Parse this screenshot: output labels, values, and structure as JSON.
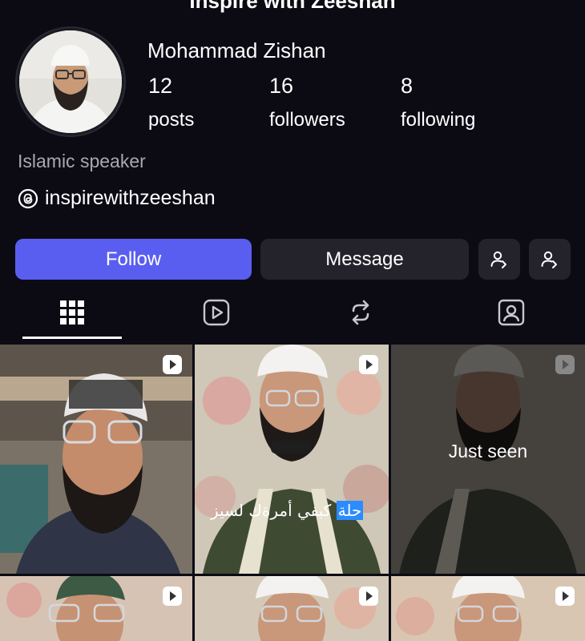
{
  "header": {
    "title_cut": "Inspire with Zeeshan"
  },
  "profile": {
    "name": "Mohammad Zishan",
    "stats": [
      {
        "value": "12",
        "label": "posts"
      },
      {
        "value": "16",
        "label": "followers"
      },
      {
        "value": "8",
        "label": "following"
      }
    ],
    "bio": "Islamic speaker",
    "threads_handle": "inspirewithzeeshan"
  },
  "actions": {
    "follow_label": "Follow",
    "message_label": "Message",
    "icon_buttons": [
      "add-person-icon",
      "add-person-icon"
    ]
  },
  "tabs": [
    {
      "icon": "grid-icon",
      "active": true
    },
    {
      "icon": "reels-icon",
      "active": false
    },
    {
      "icon": "reposts-icon",
      "active": false
    },
    {
      "icon": "tagged-icon",
      "active": false
    }
  ],
  "posts": [
    {
      "type": "reel",
      "overlay": ""
    },
    {
      "type": "reel",
      "overlay": "",
      "caption_ar": "كبفي أمرةك لسيز",
      "caption_ar_hl": "حلة"
    },
    {
      "type": "reel",
      "overlay": "Just seen"
    },
    {
      "type": "reel",
      "overlay": ""
    },
    {
      "type": "reel",
      "overlay": ""
    },
    {
      "type": "reel",
      "overlay": ""
    }
  ],
  "colors": {
    "background": "#0c0b14",
    "follow_button": "#5a5ef0",
    "secondary_button": "#24232c",
    "muted_text": "#a9a8b0"
  }
}
